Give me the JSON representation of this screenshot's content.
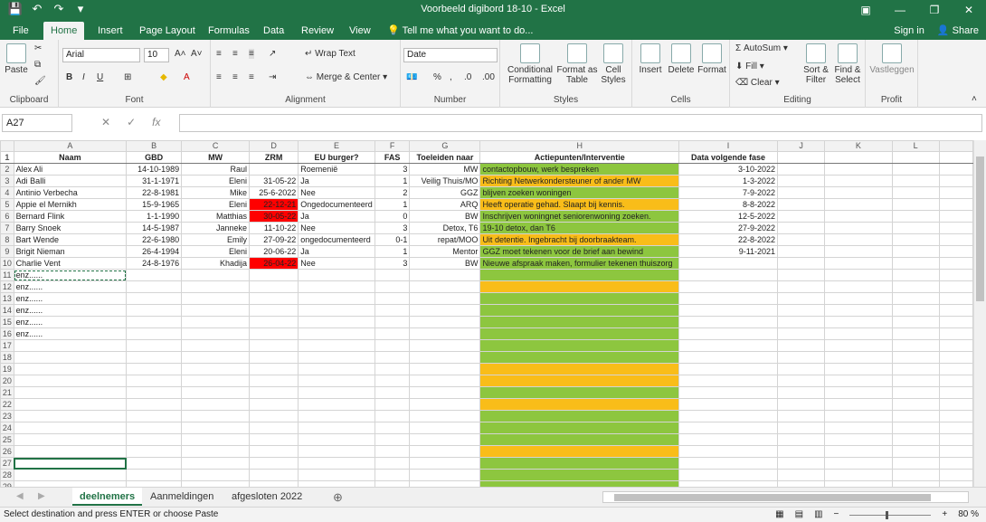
{
  "titlebar": {
    "title": "Voorbeeld digibord 18-10 - Excel",
    "sign_in": "Sign in",
    "share": "Share"
  },
  "tabs": [
    "File",
    "Home",
    "Insert",
    "Page Layout",
    "Formulas",
    "Data",
    "Review",
    "View"
  ],
  "tell_me": "Tell me what you want to do...",
  "ribbon": {
    "clipboard": {
      "label": "Clipboard",
      "paste": "Paste"
    },
    "font": {
      "label": "Font",
      "name": "Arial",
      "size": "10"
    },
    "alignment": {
      "label": "Alignment",
      "wrap": "Wrap Text",
      "merge": "Merge & Center"
    },
    "number": {
      "label": "Number",
      "format": "Date"
    },
    "styles": {
      "label": "Styles",
      "conditional": "Conditional Formatting",
      "format_table": "Format as Table",
      "cell_styles": "Cell Styles"
    },
    "cells": {
      "label": "Cells",
      "insert": "Insert",
      "delete": "Delete",
      "format": "Format"
    },
    "editing": {
      "label": "Editing",
      "autosum": "AutoSum",
      "fill": "Fill",
      "clear": "Clear",
      "sort": "Sort & Filter",
      "find": "Find & Select"
    },
    "profit": {
      "label": "Profit",
      "vastleggen": "Vastleggen"
    }
  },
  "formula_bar": {
    "name_box": "A27",
    "formula": ""
  },
  "columns": [
    "A",
    "B",
    "C",
    "D",
    "E",
    "F",
    "G",
    "H",
    "I",
    "J",
    "K",
    "L"
  ],
  "headers": [
    "Naam",
    "GBD",
    "MW",
    "ZRM",
    "EU burger?",
    "FAS",
    "Toeleiden naar",
    "Actiepunten/Interventie",
    "Data volgende fase",
    "",
    "",
    ""
  ],
  "rows": [
    [
      "Alex Ali",
      "14-10-1989",
      "Raul",
      "",
      "Roemenië",
      "3",
      "MW",
      "contactopbouw, werk bespreken",
      "3-10-2022"
    ],
    [
      "Adi Balli",
      "31-1-1971",
      "Eleni",
      "31-05-22",
      "Ja",
      "1",
      "Veilig Thuis/MO",
      "Richting Netwerkondersteuner of ander MW",
      "1-3-2022"
    ],
    [
      "Antinio Verbecha",
      "22-8-1981",
      "Mike",
      "25-6-2022",
      "Nee",
      "2",
      "GGZ",
      "blijven zoeken woningen",
      "7-9-2022"
    ],
    [
      "Appie el Mernikh",
      "15-9-1965",
      "Eleni",
      "22-12-21",
      "Ongedocumenteerd",
      "1",
      "ARQ",
      "Heeft operatie gehad. Slaapt bij kennis.",
      "8-8-2022"
    ],
    [
      "Bernard Flink",
      "1-1-1990",
      "Matthias",
      "30-05-22",
      "Ja",
      "0",
      "BW",
      "Inschrijven woningnet seniorenwoning zoeken.",
      "12-5-2022"
    ],
    [
      "Barry Snoek",
      "14-5-1987",
      "Janneke",
      "11-10-22",
      "Nee",
      "3",
      "Detox, T6",
      "19-10 detox, dan T6",
      "27-9-2022"
    ],
    [
      "Bart Wende",
      "22-6-1980",
      "Emily",
      "27-09-22",
      "ongedocumenteerd",
      "0-1",
      "repat/MOO",
      "Uit detentie. Ingebracht bij doorbraakteam.",
      "22-8-2022"
    ],
    [
      "Brigit Nieman",
      "26-4-1994",
      "Eleni",
      "20-06-22",
      "Ja",
      "1",
      "Mentor",
      "GGZ moet tekenen voor de brief aan bewind",
      "9-11-2021"
    ],
    [
      "Charlie Vent",
      "24-8-1976",
      "Khadija",
      "26-04-22",
      "Nee",
      "3",
      "BW",
      "Nieuwe afspraak maken, formulier tekenen thuiszorg",
      ""
    ]
  ],
  "enz_rows": [
    "enz......",
    "enz......",
    "enz......",
    "enz......",
    "enz......",
    "enz......"
  ],
  "sheets": [
    "deelnemers",
    "Aanmeldingen",
    "afgesloten 2022"
  ],
  "status": {
    "message": "Select destination and press ENTER or choose Paste",
    "zoom": "80 %"
  }
}
